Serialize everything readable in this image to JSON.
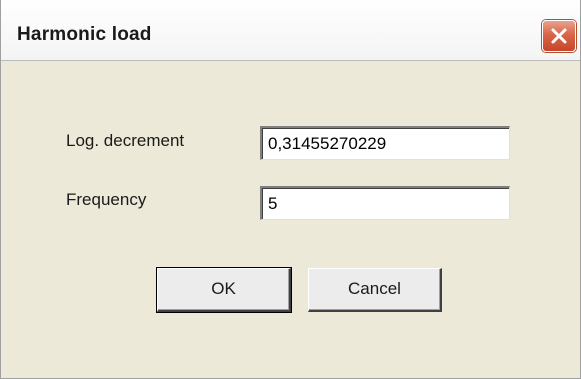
{
  "window": {
    "title": "Harmonic load"
  },
  "fields": [
    {
      "label": "Log. decrement",
      "value": "0,31455270229"
    },
    {
      "label": "Frequency",
      "value": "5"
    }
  ],
  "buttons": {
    "ok_label": "OK",
    "cancel_label": "Cancel"
  },
  "icons": {
    "close": "close-icon"
  },
  "colors": {
    "dialog_background": "#ece9d8",
    "close_button": "#d9654a"
  }
}
